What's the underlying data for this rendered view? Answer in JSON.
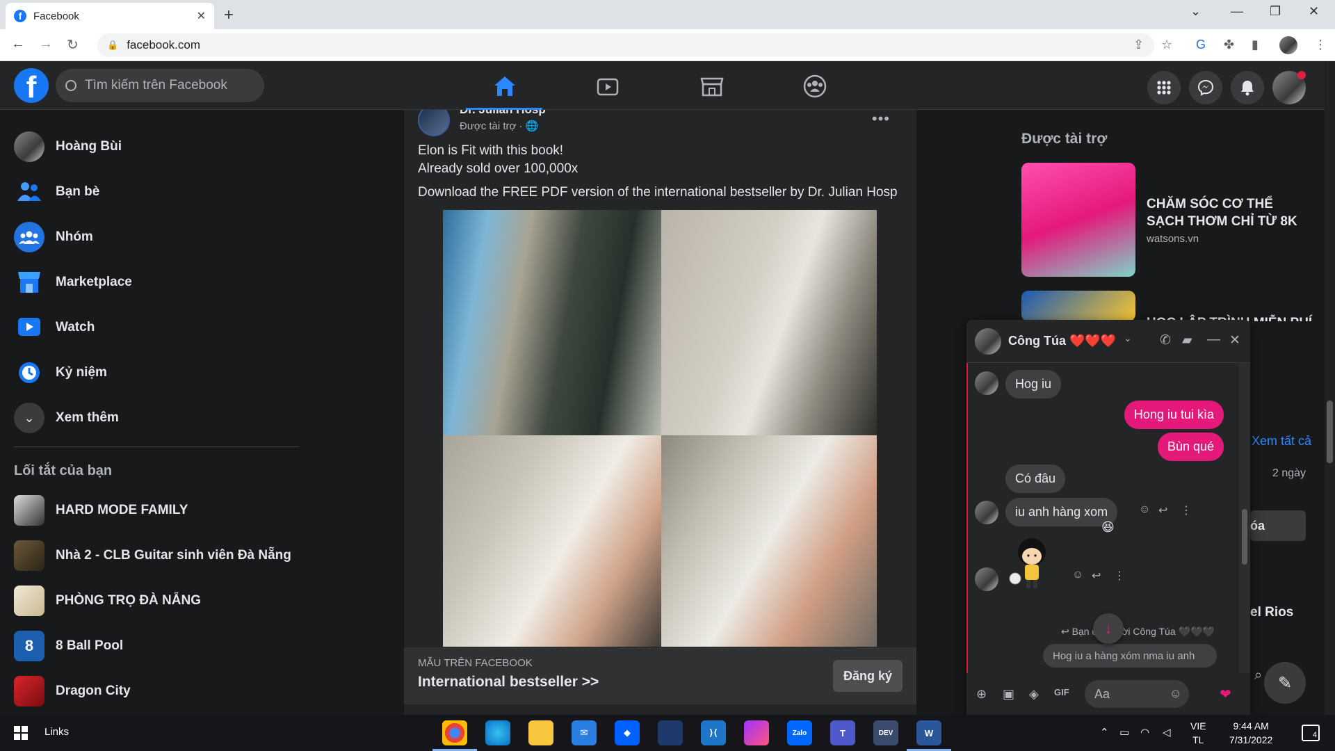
{
  "browser": {
    "tab_title": "Facebook",
    "tab_close": "✕",
    "new_tab": "+",
    "url": "facebook.com"
  },
  "fb": {
    "search_placeholder": "Tìm kiếm trên Facebook"
  },
  "sidebar": {
    "items": [
      {
        "label": "Hoàng Bùi"
      },
      {
        "label": "Bạn bè"
      },
      {
        "label": "Nhóm"
      },
      {
        "label": "Marketplace"
      },
      {
        "label": "Watch"
      },
      {
        "label": "Kỷ niệm"
      },
      {
        "label": "Xem thêm"
      }
    ],
    "shortcuts_heading": "Lối tắt của bạn",
    "shortcuts": [
      {
        "label": "HARD MODE FAMILY"
      },
      {
        "label": "Nhà 2 - CLB Guitar sinh viên Đà Nẵng"
      },
      {
        "label": "PHÒNG TRỌ ĐÀ NẴNG"
      },
      {
        "label": "8 Ball Pool"
      },
      {
        "label": "Dragon City"
      }
    ]
  },
  "post": {
    "author": "Dr. Julian Hosp",
    "sponsored": "Được tài trợ · 🌐",
    "more": "•••",
    "line1": "Elon is Fit with this book!",
    "line2": "Already sold over 100,000x",
    "line3": "Download the FREE PDF version of the international bestseller by Dr. Julian Hosp",
    "footer_caption": "MẪU TRÊN FACEBOOK",
    "footer_title": "International bestseller >>",
    "cta": "Đăng ký"
  },
  "right": {
    "sponsored_heading": "Được tài trợ",
    "ads": [
      {
        "title": "CHĂM SÓC CƠ THỂ SẠCH THƠM CHỈ TỪ 8K",
        "domain": "watsons.vn"
      },
      {
        "title": "HỌC LẬP TRÌNH MIỄN PHÍ ... TÀI TRỢ",
        "domain": ""
      }
    ],
    "see_all": "Xem tất cả",
    "two_days": "2 ngày",
    "delete_partial": "óa",
    "contact_partial": "el Rios"
  },
  "chat": {
    "name": "Công Túa ❤️❤️❤️",
    "messages": [
      {
        "from": "them",
        "text": "Hog iu"
      },
      {
        "from": "me",
        "text": "Hong iu tui kìa"
      },
      {
        "from": "me",
        "text": "Bùn qué"
      },
      {
        "from": "them",
        "text": "Có đâu"
      },
      {
        "from": "them",
        "text": "iu anh hàng xom"
      }
    ],
    "reaction": "😆",
    "reply_info": "↩ Bạn đã trả lời Công Túa 🖤🖤🖤",
    "reply_text": "Hog iu a hàng xóm nma iu anh",
    "composer_placeholder": "Aa"
  },
  "taskbar": {
    "links": "Links",
    "lang1": "VIE",
    "lang2": "TL",
    "time": "9:44 AM",
    "date": "7/31/2022",
    "notif_count": "4",
    "apps": [
      "chrome",
      "edge",
      "file-explorer",
      "mail",
      "dropbox",
      "powertoys",
      "vscode",
      "messenger",
      "zalo",
      "teams",
      "dev-c++",
      "word"
    ]
  },
  "colors": {
    "accent": "#1877f2",
    "chat_bubble_out": "#e4197a",
    "chat_bubble_in": "#3e4042",
    "background": "#18191a",
    "card": "#242526"
  }
}
